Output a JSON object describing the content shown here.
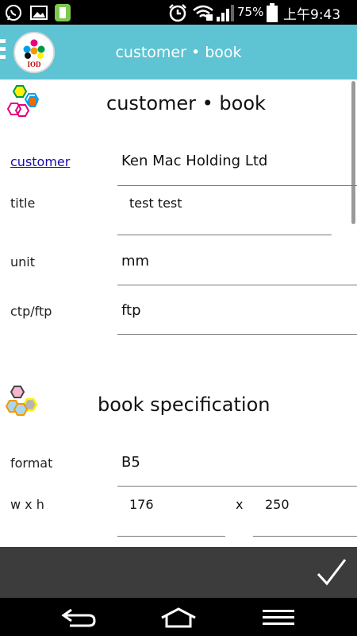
{
  "status_bar": {
    "battery_percent": "75%",
    "time": "上午9:43"
  },
  "app_bar": {
    "logo_text": "IOD",
    "title": "customer • book"
  },
  "sections": {
    "customer_book": {
      "title": "customer • book",
      "fields": {
        "customer": {
          "label": "customer",
          "value": "Ken Mac Holding Ltd"
        },
        "title": {
          "label": "title",
          "value": "test test"
        },
        "unit": {
          "label": "unit",
          "value": "mm"
        },
        "ctp_ftp": {
          "label": "ctp/ftp",
          "value": "ftp"
        }
      }
    },
    "book_spec": {
      "title": "book specification",
      "fields": {
        "format": {
          "label": "format",
          "value": "B5"
        },
        "wxh": {
          "label": "w x h",
          "width": "176",
          "separator": "x",
          "height": "250"
        }
      }
    }
  },
  "colors": {
    "appbar": "#5ec3d3",
    "status_bar": "#000000",
    "action_bar": "#3c3c3c",
    "link": "#1a0dab"
  },
  "icons": {
    "statusbar": [
      "whatsapp-icon",
      "image-icon",
      "battery-app-icon",
      "alarm-icon",
      "wifi-icon",
      "signal-icon",
      "battery-icon"
    ],
    "navbar": [
      "back-icon",
      "home-icon",
      "menu-icon"
    ],
    "action": "checkmark-icon"
  }
}
